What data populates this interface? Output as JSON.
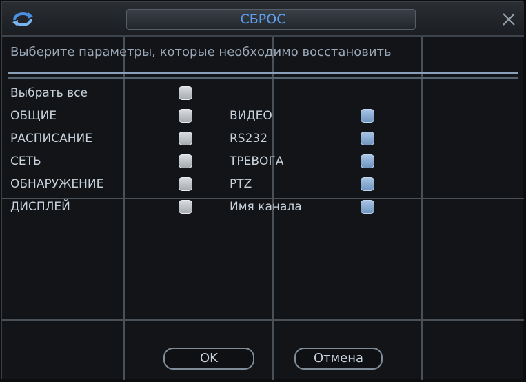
{
  "dialog": {
    "title": "СБРОС",
    "subtitle": "Выберите параметры, которые необходимо восстановить",
    "select_all": {
      "label": "Выбрать все",
      "checked": false
    },
    "options_left": [
      {
        "label": "ОБЩИЕ",
        "checked": false
      },
      {
        "label": "РАСПИСАНИЕ",
        "checked": false
      },
      {
        "label": "СЕТЬ",
        "checked": false
      },
      {
        "label": "ОБНАРУЖЕНИЕ",
        "checked": false
      },
      {
        "label": "ДИСПЛЕЙ",
        "checked": false
      }
    ],
    "options_right": [
      {
        "label": "ВИДЕО",
        "checked": false
      },
      {
        "label": "RS232",
        "checked": false
      },
      {
        "label": "ТРЕВОГА",
        "checked": false
      },
      {
        "label": "PTZ",
        "checked": false
      },
      {
        "label": "Имя канала",
        "checked": false
      }
    ],
    "buttons": {
      "ok_label": "OK",
      "cancel_label": "Отмена"
    },
    "icons": {
      "logo": "refresh-logo-icon",
      "close": "close-icon"
    },
    "colors": {
      "title": "#5fa0f0",
      "text": "#c8d2dc",
      "accent_line": "#8aa0b8"
    }
  }
}
